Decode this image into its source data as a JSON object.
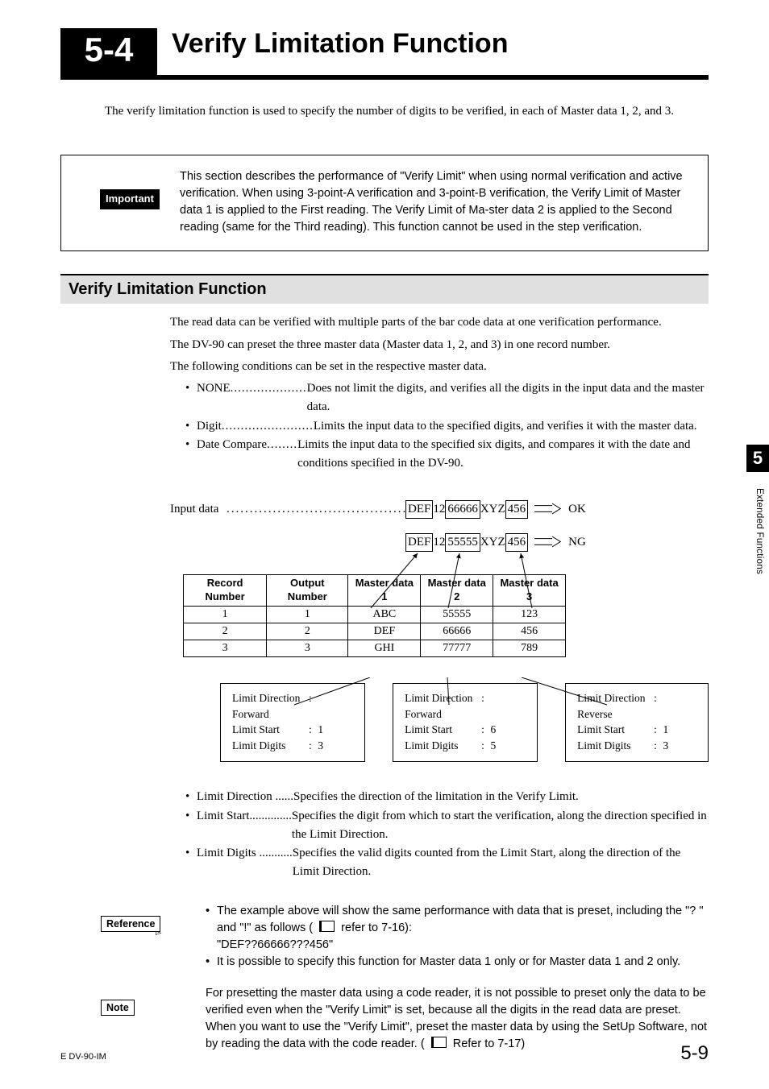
{
  "chapter": {
    "number": "5-4",
    "title": "Verify Limitation Function"
  },
  "intro": "The verify limitation function is used to specify the number of digits to be verified, in each of Master data 1, 2, and 3.",
  "important": {
    "tag": "Important",
    "text": "This section describes the performance of \"Verify Limit\" when using normal verification and active verification. When using 3-point-A verification and 3-point-B verification, the Verify Limit of Master data 1 is applied to the First reading. The Verify Limit of Ma-ster data 2 is applied to the Second reading (same for the Third reading). This function cannot be used in the step verification."
  },
  "sub_heading": "Verify Limitation Function",
  "body1": "The read data can be verified with multiple parts of the bar code data at one verification performance.",
  "body2": "The DV-90 can preset the three master data (Master data 1, 2, and 3) in one record number.",
  "body3": "The following conditions can be set in the respective master data.",
  "modes": [
    {
      "name": "NONE",
      "dots": "....................",
      "desc": "Does not limit the digits, and verifies all the digits in the input data and the master data."
    },
    {
      "name": "Digit",
      "dots": "........................",
      "desc": "Limits the input data to the specified digits, and verifies it with the master data."
    },
    {
      "name": "Date Compare",
      "dots": "........",
      "desc": "Limits the input data to the specified six digits, and compares it with the date and conditions specified in the DV-90."
    }
  ],
  "input_label": "Input data",
  "input_dots": "..................................................",
  "input_rows": [
    {
      "seg1": "DEF",
      "seg2": "12",
      "seg3": "66666",
      "seg4": "XYZ",
      "seg5": "456",
      "result": "OK"
    },
    {
      "seg1": "DEF",
      "seg2": "12",
      "seg3": "55555",
      "seg4": "XYZ",
      "seg5": "456",
      "result": "NG"
    }
  ],
  "table": {
    "headers": [
      "Record Number",
      "Output Number",
      "Master data 1",
      "Master data 2",
      "Master data 3"
    ],
    "rows": [
      [
        "1",
        "1",
        "ABC",
        "55555",
        "123"
      ],
      [
        "2",
        "2",
        "DEF",
        "66666",
        "456"
      ],
      [
        "3",
        "3",
        "GHI",
        "77777",
        "789"
      ]
    ]
  },
  "limits": [
    {
      "direction": "Forward",
      "start": "1",
      "digits": "3"
    },
    {
      "direction": "Forward",
      "start": "6",
      "digits": "5"
    },
    {
      "direction": "Reverse",
      "start": "1",
      "digits": "3"
    }
  ],
  "limit_labels": {
    "dir": "Limit Direction",
    "start": "Limit Start",
    "digits": "Limit Digits"
  },
  "defs": [
    {
      "name": "Limit Direction",
      "dots": "......",
      "desc": "Specifies the direction of the limitation in the Verify Limit."
    },
    {
      "name": "Limit Start",
      "dots": "..............",
      "desc": "Specifies the digit from which to start the verification, along the direction specified in the Limit Direction."
    },
    {
      "name": "Limit Digits",
      "dots": "...........",
      "desc": "Specifies the valid digits counted from the Limit Start, along the direction of the Limit Direction."
    }
  ],
  "reference": {
    "tag": "Reference",
    "line1_a": "The example above will show the same performance with data that is preset, including the \"? \" and \"!\" as follows (",
    "line1_b": " refer to 7-16):",
    "line2": "\"DEF??66666???456\"",
    "line3": "It is possible to specify this function for Master data 1 only or for Master data 1 and 2 only."
  },
  "note": {
    "tag": "Note",
    "text_a": "For presetting the master data using a code reader, it is not possible to preset only the data to be verified even when the \"Verify Limit\" is set, because all the digits in the read data are preset. When you want to use the \"Verify Limit\", preset the master data by using the SetUp Software, not by reading the data with the code reader. (",
    "text_b": " Refer to 7-17)"
  },
  "side": {
    "num": "5",
    "label": "Extended Functions"
  },
  "footer": {
    "id": "E DV-90-IM",
    "page": "5-9"
  }
}
